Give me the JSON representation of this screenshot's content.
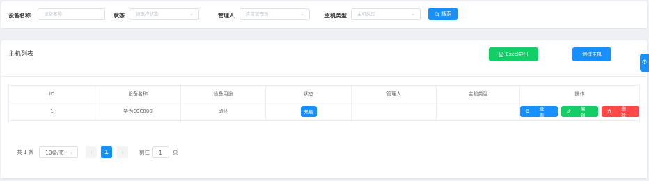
{
  "filters": {
    "device_name": {
      "label": "设备名称",
      "placeholder": "设备名称"
    },
    "status": {
      "label": "状态",
      "placeholder": "请选择状态"
    },
    "manager": {
      "label": "管理人",
      "placeholder": "库房管理员"
    },
    "host_type": {
      "label": "主机类型",
      "placeholder": "主机类型"
    },
    "search_label": "搜索"
  },
  "section": {
    "title": "主机列表",
    "export_label": "Excel导出",
    "create_label": "创建主机"
  },
  "table": {
    "headers": [
      "ID",
      "设备名称",
      "设备用途",
      "状态",
      "管理人",
      "主机类型",
      "操作"
    ],
    "rows": [
      {
        "id": "1",
        "name": "华为ECC800",
        "usage": "动环",
        "status": "开启",
        "manager": "",
        "host_type": "",
        "actions": {
          "view": "查看",
          "edit": "编辑",
          "delete": "删除"
        }
      }
    ]
  },
  "pagination": {
    "total": "共 1 条",
    "page_size": "10条/页",
    "current_page": "1",
    "jump_prefix": "前往",
    "jump_value": "1",
    "jump_suffix": "页"
  },
  "colors": {
    "primary": "#1890ff",
    "success": "#13ce66",
    "danger": "#ff4949"
  },
  "icons": {
    "search": "search-icon",
    "export": "document-icon",
    "view": "search-icon",
    "edit": "edit-icon",
    "delete": "trash-icon",
    "side": "gear-icon"
  }
}
